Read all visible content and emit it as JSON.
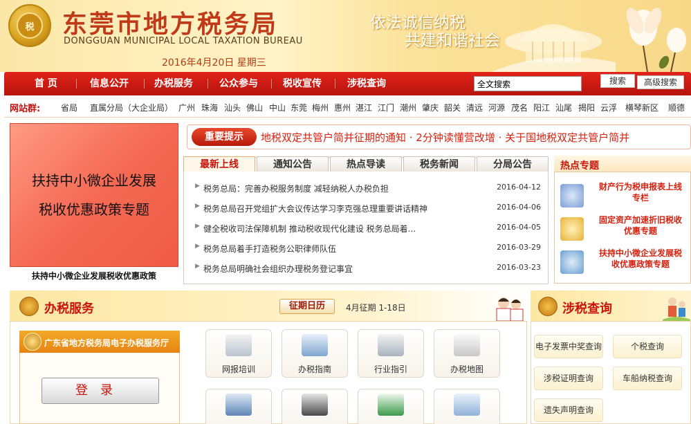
{
  "header": {
    "emblem_text": "税",
    "title_cn": "东莞市地方税务局",
    "title_en": "DONGGUAN MUNICIPAL LOCAL TAXATION BUREAU",
    "date": "2016年4月20日 星期三",
    "slogan_line1": "依法诚信纳税",
    "slogan_line2": "共建和谐社会"
  },
  "nav": {
    "items": [
      "首 页",
      "信息公开",
      "办税服务",
      "公众参与",
      "税收宣传",
      "涉税查询"
    ],
    "search_value": "全文搜索",
    "search_button": "搜索",
    "advanced_button": "高级搜索"
  },
  "sites": {
    "label": "网站群:",
    "items": [
      "省局",
      "直属分局（大企业局）",
      "广州",
      "珠海",
      "汕头",
      "佛山",
      "中山",
      "东莞",
      "梅州",
      "惠州",
      "湛江",
      "江门",
      "潮州",
      "肇庆",
      "韶关",
      "清远",
      "河源",
      "茂名",
      "阳江",
      "汕尾",
      "揭阳",
      "云浮",
      "横琴新区",
      "顺德"
    ]
  },
  "left_banner": {
    "line1": "扶持中小微企业发展",
    "line2": "税收优惠政策专题",
    "caption": "扶持中小微企业发展税收优惠政策"
  },
  "notice": {
    "badge": "重要提示",
    "text": "地税双定共管户简并征期的通知  · 2分钟读懂营改增          · 关于国地税双定共管户简并"
  },
  "news": {
    "tabs": [
      "最新上线",
      "通知公告",
      "热点导读",
      "税务新闻",
      "分局公告"
    ],
    "items": [
      {
        "title": "税务总局：完善办税服务制度  减轻纳税人办税负担",
        "date": "2016-04-12"
      },
      {
        "title": "税务总局召开党组扩大会议传达学习李克强总理重要讲话精神",
        "date": "2016-04-06"
      },
      {
        "title": "健全税收司法保障机制  推动税收现代化建设  税务总局着...",
        "date": "2016-04-05"
      },
      {
        "title": "税务总局着手打造税务公职律师队伍",
        "date": "2016-03-29"
      },
      {
        "title": "税务总局明确社会组织办理税务登记事宜",
        "date": "2016-03-23"
      }
    ]
  },
  "hot": {
    "title": "热点专题",
    "items": [
      {
        "line1": "财产行为税申报表上线",
        "line2": "专栏",
        "icon": "person-icon",
        "color": "#7a9ed6"
      },
      {
        "line1": "固定资产加速折旧税收",
        "line2": "优惠专题",
        "icon": "coins-icon",
        "color": "#e7b23a"
      },
      {
        "line1": "扶持中小微企业发展税",
        "line2": "收优惠政策专题",
        "icon": "computer-icon",
        "color": "#6a9ed0"
      }
    ]
  },
  "service": {
    "title": "办税服务",
    "calendar_button": "征期日历",
    "calendar_text": "4月征期  1-18日",
    "hall_title": "广东省地方税务局电子办税服务厅",
    "login_label": "登录",
    "tiles": [
      {
        "label": "网报培训",
        "icon": "training-icon"
      },
      {
        "label": "办税指南",
        "icon": "guide-icon"
      },
      {
        "label": "行业指引",
        "icon": "industry-icon"
      },
      {
        "label": "办税地图",
        "icon": "map-icon"
      },
      {
        "label": "",
        "icon": "book-icon"
      },
      {
        "label": "",
        "icon": "books-icon"
      },
      {
        "label": "",
        "icon": "excel-icon"
      },
      {
        "label": "",
        "icon": "download-icon"
      }
    ]
  },
  "inquiry": {
    "title": "涉税查询",
    "buttons": [
      "电子发票中奖查询",
      "个税查询",
      "涉税证明查询",
      "车船纳税查询",
      "遗失声明查询"
    ]
  }
}
